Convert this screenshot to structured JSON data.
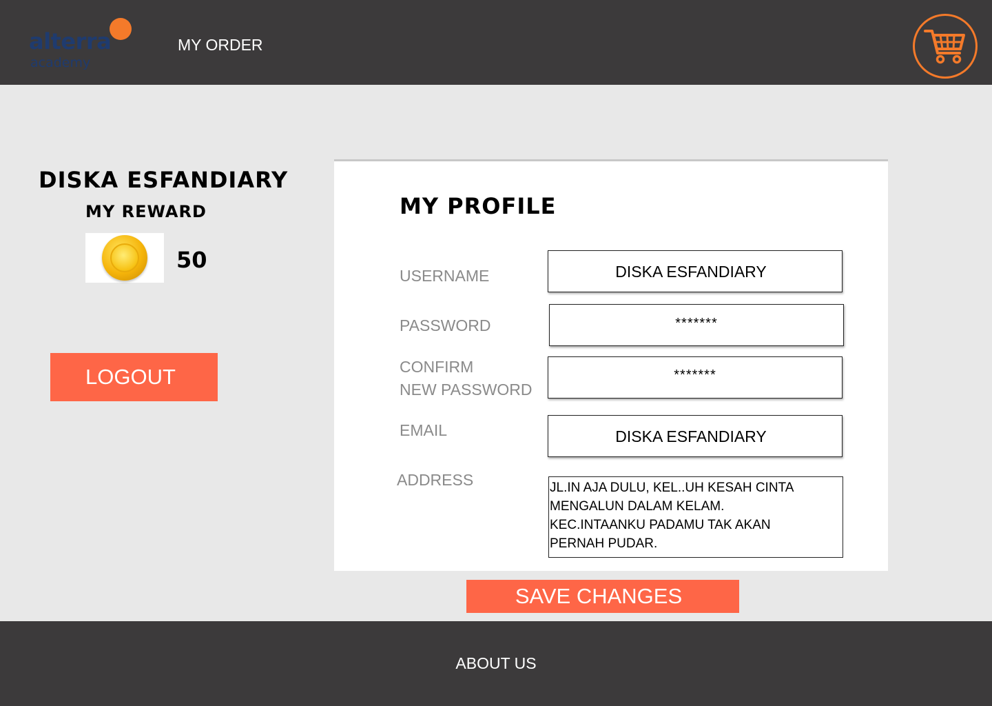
{
  "header": {
    "logo_text": "alterra",
    "logo_subtext": "academy",
    "nav_order_label": "MY ORDER",
    "cart_icon": "shopping-cart-icon"
  },
  "profile_side": {
    "user_name": "DISKA ESFANDIARY",
    "reward_title": "MY REWARD",
    "reward_icon": "gold-coin-icon",
    "reward_value": "50",
    "logout_label": "LOGOUT"
  },
  "card": {
    "title": "MY PROFILE",
    "fields": {
      "username": {
        "label": "USERNAME",
        "value": "DISKA ESFANDIARY"
      },
      "password": {
        "label": "PASSWORD",
        "value": "*******"
      },
      "confirm": {
        "label_line1": "CONFIRM",
        "label_line2": "NEW PASSWORD",
        "value": "*******"
      },
      "email": {
        "label": "EMAIL",
        "value": "DISKA ESFANDIARY"
      },
      "address": {
        "label": "ADDRESS",
        "lines": [
          "JL.IN AJA DULU, KEL..UH KESAH CINTA",
          "MENGALUN DALAM KELAM.",
          "KEC.INTAANKU PADAMU TAK AKAN",
          "PERNAH PUDAR."
        ]
      }
    }
  },
  "save_label": "SAVE CHANGES",
  "footer": {
    "about_label": "ABOUT US"
  },
  "colors": {
    "header_bg": "#3c3a3b",
    "accent": "#fe6647",
    "cart_orange": "#f47a2a",
    "page_bg": "#e8e8e8"
  }
}
